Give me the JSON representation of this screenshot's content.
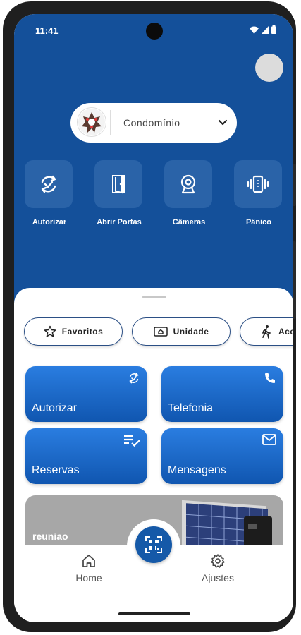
{
  "status_bar": {
    "time": "11:41"
  },
  "header": {
    "condo_selector": {
      "label": "Condomínio"
    }
  },
  "quick_actions": [
    {
      "label": "Autorizar",
      "icon": "sync-check-icon"
    },
    {
      "label": "Abrir Portas",
      "icon": "door-icon"
    },
    {
      "label": "Câmeras",
      "icon": "webcam-icon"
    },
    {
      "label": "Pânico",
      "icon": "vibrate-phone-icon"
    }
  ],
  "filters": [
    {
      "label": "Favoritos",
      "icon": "star-icon"
    },
    {
      "label": "Unidade",
      "icon": "home-card-icon"
    },
    {
      "label": "Ace",
      "icon": "walk-icon"
    }
  ],
  "cards": [
    {
      "label": "Autorizar",
      "icon": "sync-check-icon"
    },
    {
      "label": "Telefonia",
      "icon": "phone-icon"
    },
    {
      "label": "Reservas",
      "icon": "list-check-icon"
    },
    {
      "label": "Mensagens",
      "icon": "mail-icon"
    }
  ],
  "banner": {
    "label": "reuniao"
  },
  "bottom_nav": {
    "home_label": "Home",
    "settings_label": "Ajustes"
  },
  "colors": {
    "brand_blue": "#14509a",
    "card_blue": "#1e6fd0",
    "tile_blue": "#2a63a8"
  }
}
